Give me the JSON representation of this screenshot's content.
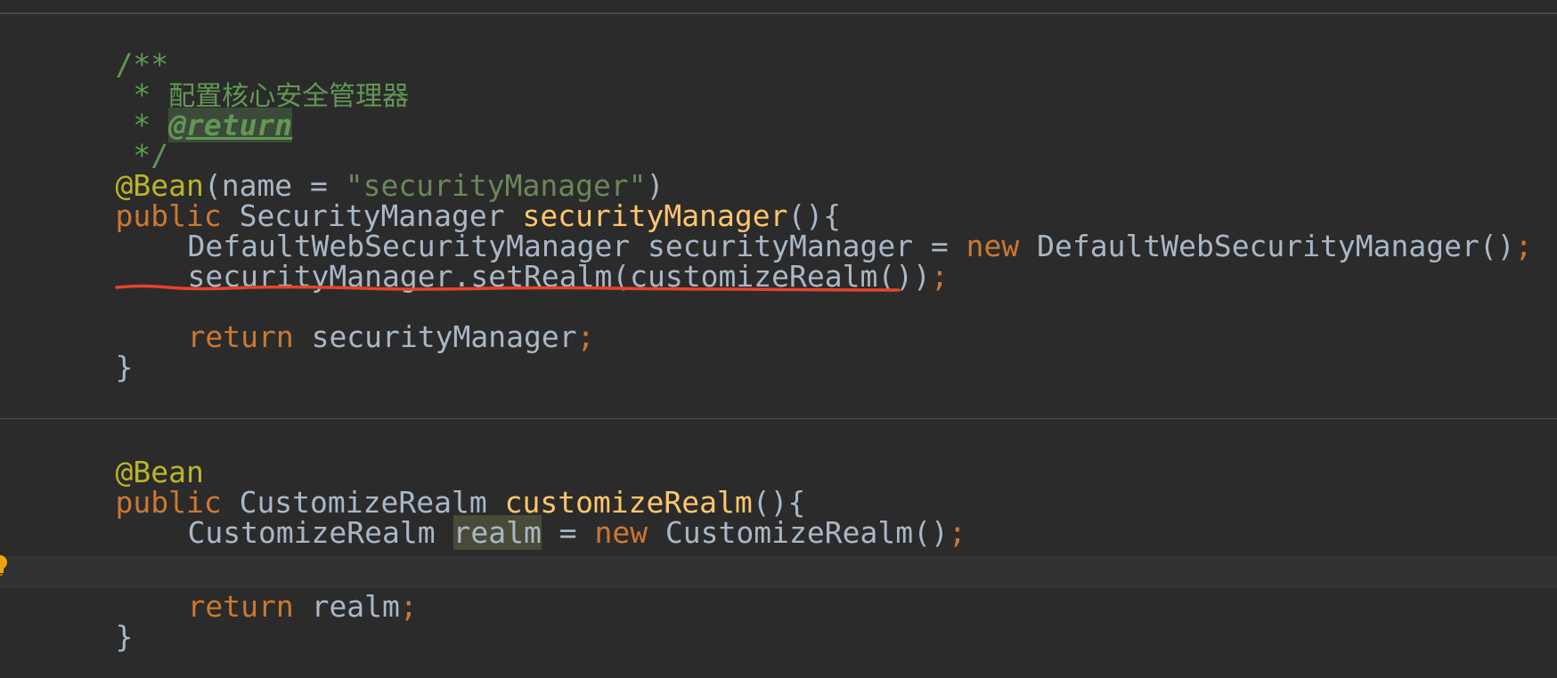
{
  "editor": {
    "language": "Java",
    "theme": "dark",
    "lines": {
      "l1": "/**",
      "l2_star": " * ",
      "l2_text": "配置核心安全管理器",
      "l3_star": " * ",
      "l3_tag": "@return",
      "l4": " */",
      "l5_annotation": "@Bean",
      "l5_open": "(",
      "l5_param": "name",
      "l5_eq": " = ",
      "l5_string": "\"securityManager\"",
      "l5_close": ")",
      "l6_kw": "public",
      "l6_type": " SecurityManager ",
      "l6_method": "securityManager",
      "l6_rest": "(){",
      "l7_type": "DefaultWebSecurityManager securityManager = ",
      "l7_kw": "new",
      "l7_rest": " DefaultWebSecurityManager()",
      "l7_semi": ";",
      "l8_code": "securityManager.setRealm(customizeRealm())",
      "l8_semi": ";",
      "l10_kw": "return",
      "l10_rest": " securityManager",
      "l10_semi": ";",
      "l11": "}",
      "l13_annotation": "@Bean",
      "l14_kw": "public",
      "l14_type": " CustomizeRealm ",
      "l14_method": "customizeRealm",
      "l14_rest": "(){",
      "l15_type": "CustomizeRealm ",
      "l15_var": "realm",
      "l15_eq": " = ",
      "l15_kw": "new",
      "l15_rest": " CustomizeRealm()",
      "l15_semi": ";",
      "l17_kw": "return",
      "l17_rest": " realm",
      "l17_semi": ";",
      "l18": "}"
    }
  },
  "colors": {
    "background": "#2b2b2b",
    "comment": "#629755",
    "keyword": "#cc7832",
    "annotation": "#bbb529",
    "string": "#6a8759",
    "method_declaration": "#ffc66d",
    "text": "#a9b7c6",
    "annotation_underline": "#e8432a",
    "intention_bulb": "#f0a30a"
  },
  "icons": {
    "gutter": "intention-bulb-icon",
    "markup": "red-hand-drawn-underline"
  }
}
